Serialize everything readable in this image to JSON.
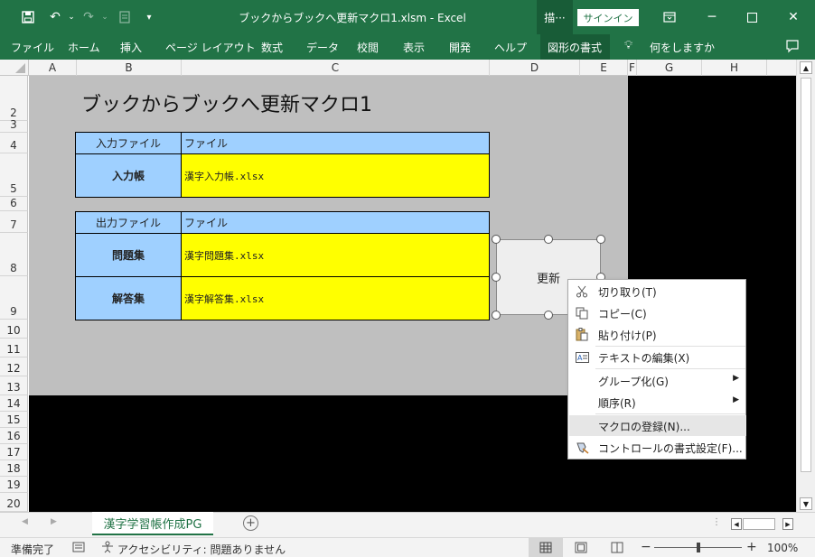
{
  "titlebar": {
    "title": "ブックからブックへ更新マクロ1.xlsm  -  Excel",
    "draw_tab": "描···",
    "signin": "サインイン"
  },
  "ribbon": {
    "tabs": [
      "ファイル",
      "ホーム",
      "挿入",
      "ページ レイアウト",
      "数式",
      "データ",
      "校閲",
      "表示",
      "開発",
      "ヘルプ",
      "図形の書式"
    ],
    "tellme": "何をしますか"
  },
  "columns": [
    "A",
    "B",
    "C",
    "D",
    "E",
    "F",
    "G",
    "H"
  ],
  "rows": [
    "2",
    "3",
    "4",
    "5",
    "6",
    "7",
    "8",
    "9",
    "10",
    "11",
    "12",
    "13",
    "14",
    "15",
    "16",
    "17",
    "18",
    "19",
    "20"
  ],
  "sheet": {
    "title": "ブックからブックへ更新マクロ1",
    "input_header_label": "入力ファイル",
    "input_header_value": "ファイル",
    "input_row_label": "入力帳",
    "input_row_value": "漢字入力帳.xlsx",
    "output_header_label": "出力ファイル",
    "output_header_value": "ファイル",
    "output_row1_label": "問題集",
    "output_row1_value": "漢字問題集.xlsx",
    "output_row2_label": "解答集",
    "output_row2_value": "漢字解答集.xlsx",
    "shape_button_label": "更新"
  },
  "context_menu": {
    "items": [
      {
        "label": "切り取り(T)",
        "icon": "scissors-icon"
      },
      {
        "label": "コピー(C)",
        "icon": "copy-icon"
      },
      {
        "label": "貼り付け(P)",
        "icon": "paste-icon"
      },
      {
        "label": "テキストの編集(X)",
        "icon": "text-edit-icon"
      },
      {
        "label": "グループ化(G)",
        "icon": ""
      },
      {
        "label": "順序(R)",
        "icon": ""
      },
      {
        "label": "マクロの登録(N)...",
        "icon": ""
      },
      {
        "label": "コントロールの書式設定(F)...",
        "icon": "format-control-icon"
      }
    ],
    "highlight_color": "#e6e6e6"
  },
  "sheet_tabs": {
    "active": "漢字学習帳作成PG"
  },
  "statusbar": {
    "ready": "準備完了",
    "accessibility": "アクセシビリティ: 問題ありません",
    "zoom": "100%"
  },
  "colors": {
    "excel_green": "#217346",
    "label_blue": "#9fd0ff",
    "value_yellow": "#ffff00"
  }
}
